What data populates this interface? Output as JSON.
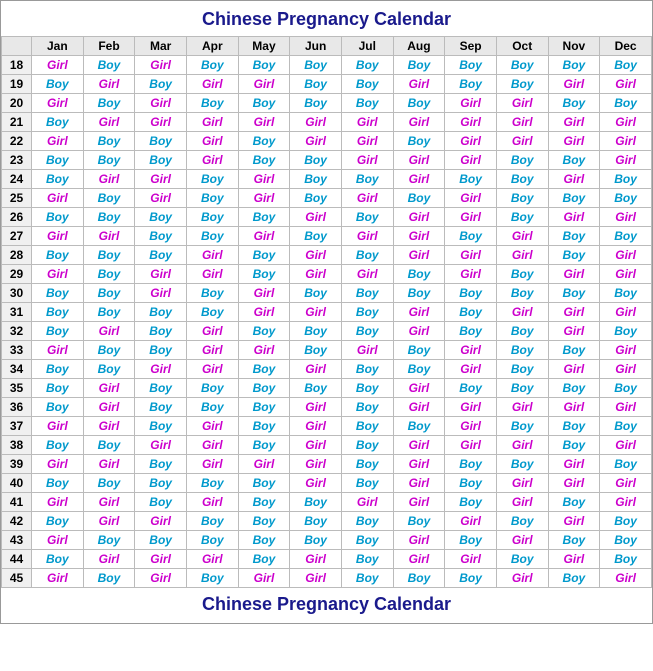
{
  "title": "Chinese Pregnancy Calendar",
  "footer": "Chinese Pregnancy Calendar",
  "columns": [
    "",
    "Jan",
    "Feb",
    "Mar",
    "Apr",
    "May",
    "Jun",
    "Jul",
    "Aug",
    "Sep",
    "Oct",
    "Nov",
    "Dec"
  ],
  "rows": [
    {
      "age": 18,
      "values": [
        "Girl",
        "Boy",
        "Girl",
        "Boy",
        "Boy",
        "Boy",
        "Boy",
        "Boy",
        "Boy",
        "Boy",
        "Boy",
        "Boy"
      ]
    },
    {
      "age": 19,
      "values": [
        "Boy",
        "Girl",
        "Boy",
        "Girl",
        "Girl",
        "Boy",
        "Boy",
        "Girl",
        "Boy",
        "Boy",
        "Girl",
        "Girl"
      ]
    },
    {
      "age": 20,
      "values": [
        "Girl",
        "Boy",
        "Girl",
        "Boy",
        "Boy",
        "Boy",
        "Boy",
        "Boy",
        "Girl",
        "Girl",
        "Boy",
        "Boy"
      ]
    },
    {
      "age": 21,
      "values": [
        "Boy",
        "Girl",
        "Girl",
        "Girl",
        "Girl",
        "Girl",
        "Girl",
        "Girl",
        "Girl",
        "Girl",
        "Girl",
        "Girl"
      ]
    },
    {
      "age": 22,
      "values": [
        "Girl",
        "Boy",
        "Boy",
        "Girl",
        "Boy",
        "Girl",
        "Girl",
        "Boy",
        "Girl",
        "Girl",
        "Girl",
        "Girl"
      ]
    },
    {
      "age": 23,
      "values": [
        "Boy",
        "Boy",
        "Boy",
        "Girl",
        "Boy",
        "Boy",
        "Girl",
        "Girl",
        "Girl",
        "Boy",
        "Boy",
        "Girl"
      ]
    },
    {
      "age": 24,
      "values": [
        "Boy",
        "Girl",
        "Girl",
        "Boy",
        "Girl",
        "Boy",
        "Boy",
        "Girl",
        "Boy",
        "Boy",
        "Girl",
        "Boy"
      ]
    },
    {
      "age": 25,
      "values": [
        "Girl",
        "Boy",
        "Girl",
        "Boy",
        "Girl",
        "Boy",
        "Girl",
        "Boy",
        "Girl",
        "Boy",
        "Boy",
        "Boy"
      ]
    },
    {
      "age": 26,
      "values": [
        "Boy",
        "Boy",
        "Boy",
        "Boy",
        "Boy",
        "Girl",
        "Boy",
        "Girl",
        "Girl",
        "Boy",
        "Girl",
        "Girl"
      ]
    },
    {
      "age": 27,
      "values": [
        "Girl",
        "Girl",
        "Boy",
        "Boy",
        "Girl",
        "Boy",
        "Girl",
        "Girl",
        "Boy",
        "Girl",
        "Boy",
        "Boy"
      ]
    },
    {
      "age": 28,
      "values": [
        "Boy",
        "Boy",
        "Boy",
        "Girl",
        "Boy",
        "Girl",
        "Boy",
        "Girl",
        "Girl",
        "Girl",
        "Boy",
        "Girl"
      ]
    },
    {
      "age": 29,
      "values": [
        "Girl",
        "Boy",
        "Girl",
        "Girl",
        "Boy",
        "Girl",
        "Girl",
        "Boy",
        "Girl",
        "Boy",
        "Girl",
        "Girl"
      ]
    },
    {
      "age": 30,
      "values": [
        "Boy",
        "Boy",
        "Girl",
        "Boy",
        "Girl",
        "Boy",
        "Boy",
        "Boy",
        "Boy",
        "Boy",
        "Boy",
        "Boy"
      ]
    },
    {
      "age": 31,
      "values": [
        "Boy",
        "Boy",
        "Boy",
        "Boy",
        "Girl",
        "Girl",
        "Boy",
        "Girl",
        "Boy",
        "Girl",
        "Girl",
        "Girl"
      ]
    },
    {
      "age": 32,
      "values": [
        "Boy",
        "Girl",
        "Boy",
        "Girl",
        "Boy",
        "Boy",
        "Boy",
        "Girl",
        "Boy",
        "Boy",
        "Girl",
        "Boy"
      ]
    },
    {
      "age": 33,
      "values": [
        "Girl",
        "Boy",
        "Boy",
        "Girl",
        "Girl",
        "Boy",
        "Girl",
        "Boy",
        "Girl",
        "Boy",
        "Boy",
        "Girl"
      ]
    },
    {
      "age": 34,
      "values": [
        "Boy",
        "Boy",
        "Girl",
        "Girl",
        "Boy",
        "Girl",
        "Boy",
        "Boy",
        "Girl",
        "Boy",
        "Girl",
        "Girl"
      ]
    },
    {
      "age": 35,
      "values": [
        "Boy",
        "Girl",
        "Boy",
        "Boy",
        "Boy",
        "Boy",
        "Boy",
        "Girl",
        "Boy",
        "Boy",
        "Boy",
        "Boy"
      ]
    },
    {
      "age": 36,
      "values": [
        "Boy",
        "Girl",
        "Boy",
        "Boy",
        "Boy",
        "Girl",
        "Boy",
        "Girl",
        "Girl",
        "Girl",
        "Girl",
        "Girl"
      ]
    },
    {
      "age": 37,
      "values": [
        "Girl",
        "Girl",
        "Boy",
        "Girl",
        "Boy",
        "Girl",
        "Boy",
        "Boy",
        "Girl",
        "Boy",
        "Boy",
        "Boy"
      ]
    },
    {
      "age": 38,
      "values": [
        "Boy",
        "Boy",
        "Girl",
        "Girl",
        "Boy",
        "Girl",
        "Boy",
        "Girl",
        "Girl",
        "Girl",
        "Boy",
        "Girl"
      ]
    },
    {
      "age": 39,
      "values": [
        "Girl",
        "Girl",
        "Boy",
        "Girl",
        "Girl",
        "Girl",
        "Boy",
        "Girl",
        "Boy",
        "Boy",
        "Girl",
        "Boy"
      ]
    },
    {
      "age": 40,
      "values": [
        "Boy",
        "Boy",
        "Boy",
        "Boy",
        "Boy",
        "Girl",
        "Boy",
        "Girl",
        "Boy",
        "Girl",
        "Girl",
        "Girl"
      ]
    },
    {
      "age": 41,
      "values": [
        "Girl",
        "Girl",
        "Boy",
        "Girl",
        "Boy",
        "Boy",
        "Girl",
        "Girl",
        "Boy",
        "Girl",
        "Boy",
        "Girl"
      ]
    },
    {
      "age": 42,
      "values": [
        "Boy",
        "Girl",
        "Girl",
        "Boy",
        "Boy",
        "Boy",
        "Boy",
        "Boy",
        "Girl",
        "Boy",
        "Girl",
        "Boy"
      ]
    },
    {
      "age": 43,
      "values": [
        "Girl",
        "Boy",
        "Boy",
        "Boy",
        "Boy",
        "Boy",
        "Boy",
        "Girl",
        "Boy",
        "Girl",
        "Boy",
        "Boy"
      ]
    },
    {
      "age": 44,
      "values": [
        "Boy",
        "Girl",
        "Girl",
        "Girl",
        "Boy",
        "Girl",
        "Boy",
        "Girl",
        "Girl",
        "Boy",
        "Girl",
        "Boy"
      ]
    },
    {
      "age": 45,
      "values": [
        "Girl",
        "Boy",
        "Girl",
        "Boy",
        "Girl",
        "Girl",
        "Boy",
        "Boy",
        "Boy",
        "Girl",
        "Boy",
        "Girl"
      ]
    }
  ]
}
